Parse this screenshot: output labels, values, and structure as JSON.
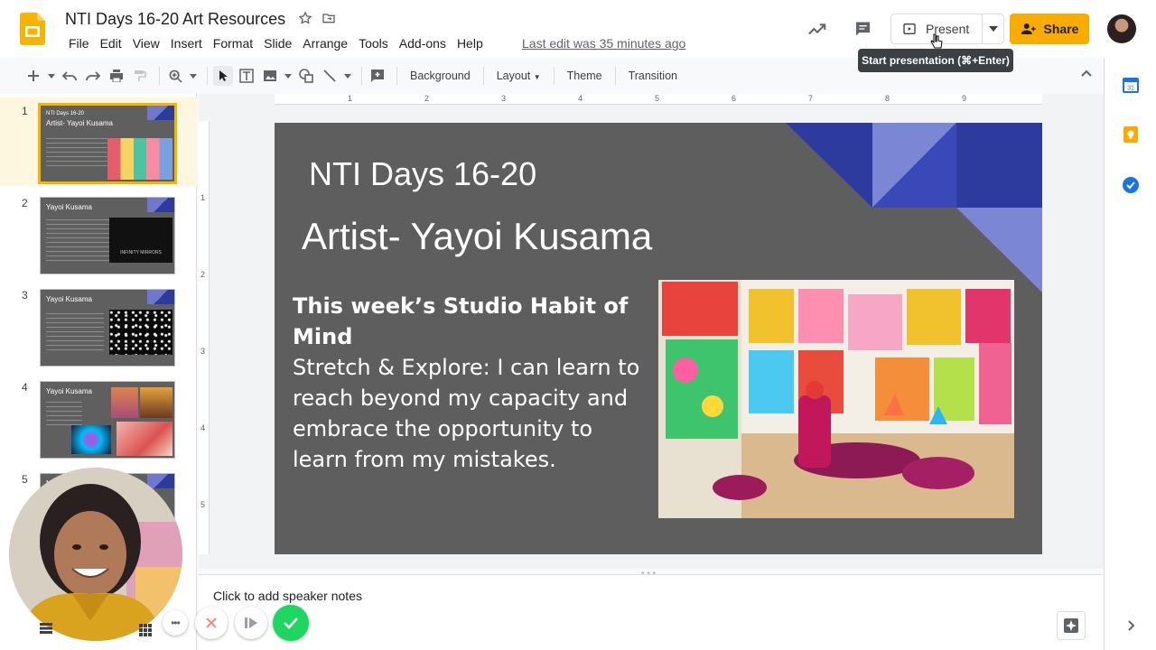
{
  "app": {
    "doc_title": "NTI Days 16-20 Art Resources",
    "last_edit": "Last edit was 35 minutes ago"
  },
  "menu": [
    "File",
    "Edit",
    "View",
    "Insert",
    "Format",
    "Slide",
    "Arrange",
    "Tools",
    "Add-ons",
    "Help"
  ],
  "header": {
    "present_label": "Present",
    "share_label": "Share",
    "tooltip": "Start presentation (⌘+Enter)"
  },
  "toolbar": {
    "background": "Background",
    "layout": "Layout",
    "theme": "Theme",
    "transition": "Transition"
  },
  "ruler": {
    "h": [
      "1",
      "2",
      "3",
      "4",
      "5",
      "6",
      "7",
      "8",
      "9"
    ],
    "v": [
      "1",
      "2",
      "3",
      "4",
      "5"
    ]
  },
  "filmstrip": [
    {
      "num": "1",
      "title": "NTI Days 16-20",
      "subtitle": "Artist- Yayoi Kusama"
    },
    {
      "num": "2",
      "title": "Yayoi Kusama",
      "subtitle": "INFINITY MIRRORS"
    },
    {
      "num": "3",
      "title": "Yayoi Kusama",
      "subtitle": ""
    },
    {
      "num": "4",
      "title": "Yayoi Kusama",
      "subtitle": ""
    },
    {
      "num": "5",
      "title": "NT",
      "subtitle": ""
    }
  ],
  "slide": {
    "title": "NTI Days 16-20",
    "subtitle": "Artist- Yayoi Kusama",
    "body_heading": "This week’s Studio Habit of Mind",
    "body_text": "Stretch & Explore: I can learn to reach beyond my capacity and embrace the opportunity to learn from my mistakes."
  },
  "notes": {
    "placeholder": "Click to add speaker notes"
  },
  "colors": {
    "accent": "#f9ab00",
    "slide_bg": "#5e5e5e",
    "selected_thumb": "#f4b400",
    "dark_blue": "#2d3a9e",
    "light_blue": "#7b86d4",
    "confirm_green": "#1ed760"
  }
}
